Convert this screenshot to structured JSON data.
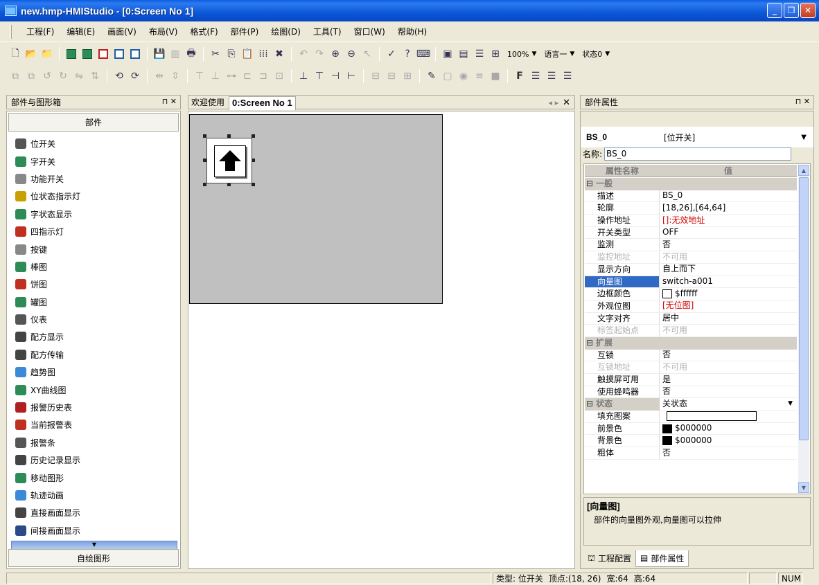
{
  "window": {
    "title": "new.hmp-HMIStudio - [0:Screen No 1]"
  },
  "menu": [
    "工程(F)",
    "编辑(E)",
    "画面(V)",
    "布局(V)",
    "格式(F)",
    "部件(P)",
    "绘图(D)",
    "工具(T)",
    "窗口(W)",
    "帮助(H)"
  ],
  "toolbar": {
    "zoom": "100%",
    "language": "语言一",
    "state": "状态0",
    "font_bold": "F"
  },
  "left_panel": {
    "title": "部件与图形箱",
    "section": "部件",
    "items": [
      "位开关",
      "字开关",
      "功能开关",
      "位状态指示灯",
      "字状态显示",
      "四指示灯",
      "按键",
      "棒图",
      "饼图",
      "罐图",
      "仪表",
      "配方显示",
      "配方传输",
      "趋势图",
      "XY曲线图",
      "报警历史表",
      "当前报警表",
      "报警条",
      "历史记录显示",
      "移动图形",
      "轨迹动画",
      "直接画面显示",
      "间接画面显示"
    ],
    "footer": "自绘图形"
  },
  "doc": {
    "tabs": [
      "欢迎使用",
      "0:Screen No 1"
    ]
  },
  "props": {
    "title": "部件属性",
    "object_name": "BS_0",
    "object_type": "[位开关]",
    "name_label": "名称:",
    "name_value": "BS_0",
    "col_name": "属性名称",
    "col_value": "值",
    "rows": [
      {
        "cat": "一般"
      },
      {
        "n": "描述",
        "v": "BS_0"
      },
      {
        "n": "轮廓",
        "v": "[18,26],[64,64]"
      },
      {
        "n": "操作地址",
        "v": "[]:无效地址",
        "red": true
      },
      {
        "n": "开关类型",
        "v": "OFF"
      },
      {
        "n": "监测",
        "v": "否"
      },
      {
        "n": "监控地址",
        "v": "不可用",
        "gray": true
      },
      {
        "n": "显示方向",
        "v": "自上而下"
      },
      {
        "n": "向量图",
        "v": "switch-a001",
        "sel": true
      },
      {
        "n": "边框颜色",
        "v": "$ffffff",
        "swatch": "#ffffff"
      },
      {
        "n": "外观位图",
        "v": "[无位图]",
        "red": true
      },
      {
        "n": "文字对齐",
        "v": "居中"
      },
      {
        "n": "标签起始点",
        "v": "不可用",
        "gray": true
      },
      {
        "cat": "扩展"
      },
      {
        "n": "互锁",
        "v": "否"
      },
      {
        "n": "互锁地址",
        "v": "不可用",
        "gray": true
      },
      {
        "n": "触摸屏可用",
        "v": "是"
      },
      {
        "n": "使用蜂鸣器",
        "v": "否"
      },
      {
        "cat": "状态",
        "v": "关状态",
        "dropdown": true
      },
      {
        "n": "填充图案",
        "v": "",
        "box": true
      },
      {
        "n": "前景色",
        "v": "$000000",
        "swatch": "#000000"
      },
      {
        "n": "背景色",
        "v": "$000000",
        "swatch": "#000000"
      },
      {
        "n": "粗体",
        "v": "否"
      }
    ],
    "desc_title": "[向量图]",
    "desc_text": "部件的向量图外观,向量图可以拉伸",
    "tabs": [
      "工程配置",
      "部件属性"
    ]
  },
  "status": {
    "type": "类型: 位开关",
    "point": "顶点:(18, 26)",
    "width": "宽:64",
    "height": "高:64",
    "num": "NUM"
  },
  "colors": {
    "titlebar": "#0b58d8",
    "canvas": "#c0c0c0",
    "selection": "#316ac5",
    "error": "#d00000"
  }
}
